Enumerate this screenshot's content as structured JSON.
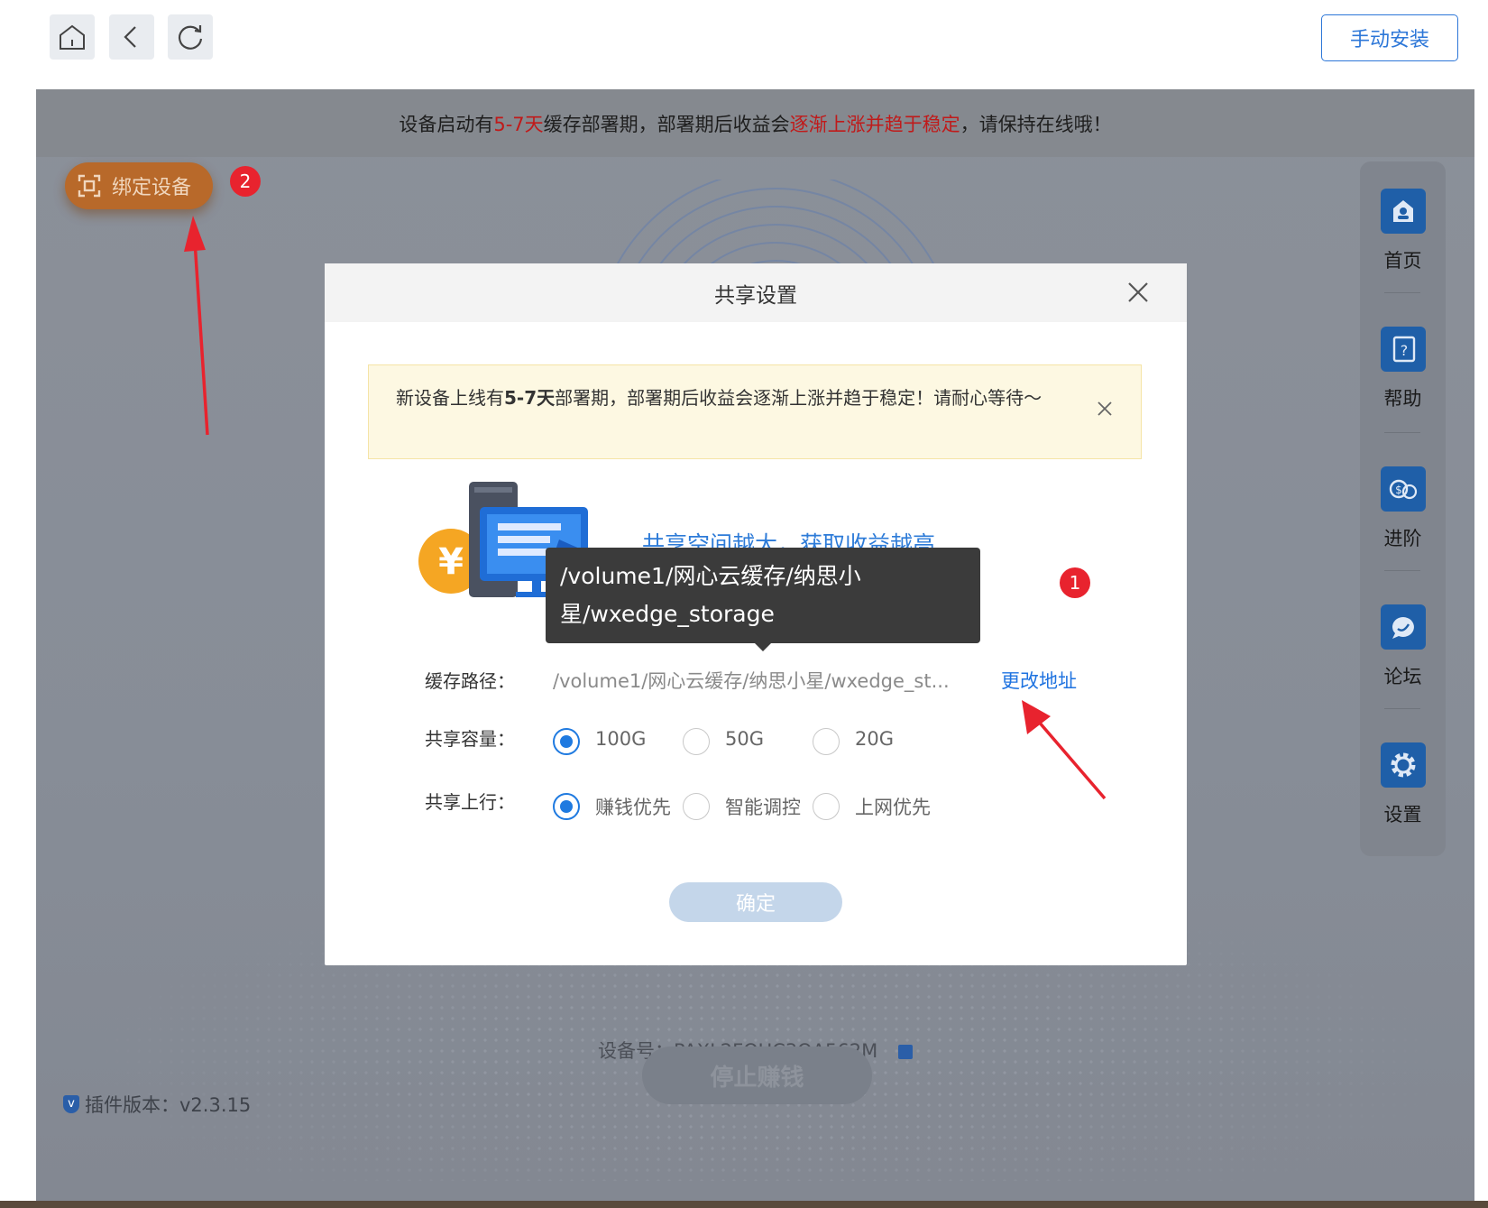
{
  "toolbar": {
    "home_icon": "home-icon",
    "back_icon": "back-arrow-icon",
    "refresh_icon": "refresh-icon",
    "manual_install_label": "手动安装"
  },
  "notice": {
    "part1": "设备启动有",
    "part2": "5-7天",
    "part3": "缓存部署期，部署期后收益会",
    "part4": "逐渐上涨并趋于稳定",
    "part5": "，请保持在线哦！"
  },
  "bind_device": {
    "label": "绑定设备"
  },
  "annotations": {
    "badge1": "1",
    "badge2": "2"
  },
  "side_nav": [
    {
      "label": "首页",
      "icon": "home-card-icon"
    },
    {
      "label": "帮助",
      "icon": "help-book-icon"
    },
    {
      "label": "进阶",
      "icon": "coins-icon"
    },
    {
      "label": "论坛",
      "icon": "chat-bubble-icon"
    },
    {
      "label": "设置",
      "icon": "gear-icon"
    }
  ],
  "device": {
    "label": "设备号：PAXL2FOUC3QA562M"
  },
  "stop_button": {
    "label": "停止赚钱"
  },
  "plugin": {
    "label": "插件版本：v2.3.15"
  },
  "modal": {
    "title": "共享设置",
    "alert_part1": "新设备上线有",
    "alert_bold": "5-7天",
    "alert_part2": "部署期，部署期后收益会逐渐上涨并趋于稳定！请耐心等待～",
    "slogan": "共享空间越大，获取收益越高",
    "path_label": "缓存路径：",
    "path_value": "/volume1/网心云缓存/纳思小星/wxedge_st...",
    "change_link": "更改地址",
    "capacity_label": "共享容量：",
    "capacity_options": [
      {
        "label": "100G",
        "selected": true
      },
      {
        "label": "50G",
        "selected": false
      },
      {
        "label": "20G",
        "selected": false
      }
    ],
    "upload_label": "共享上行：",
    "upload_options": [
      {
        "label": "赚钱优先",
        "selected": true
      },
      {
        "label": "智能调控",
        "selected": false
      },
      {
        "label": "上网优先",
        "selected": false
      }
    ],
    "confirm_label": "确定"
  },
  "tooltip": {
    "line1": "/volume1/网心云缓存/纳思小",
    "line2": "星/wxedge_storage"
  },
  "colors": {
    "accent": "#1f7ae0",
    "notice_red": "#c01a1a",
    "bind_orange": "#b8692a",
    "badge_red": "#e8232e"
  }
}
